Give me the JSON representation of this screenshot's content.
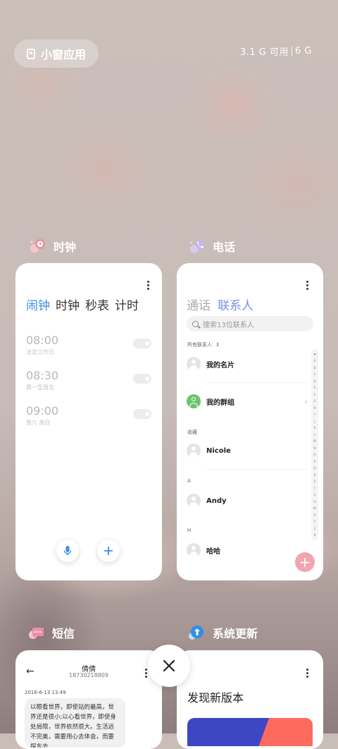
{
  "top": {
    "floating_apps_label": "小窗应用",
    "memory_available": "3.1 G 可用",
    "memory_total": "6 G"
  },
  "cards": {
    "clock": {
      "app_name": "时钟",
      "tabs": [
        "闹钟",
        "时钟",
        "秒表",
        "计时"
      ],
      "active_tab": "闹钟",
      "alarms": [
        {
          "time": "08:00",
          "repeat": "法定工作日",
          "enabled": false
        },
        {
          "time": "08:30",
          "repeat": "周一至周五",
          "enabled": false
        },
        {
          "time": "09:00",
          "repeat": "周六 周日",
          "enabled": false
        }
      ]
    },
    "phone": {
      "app_name": "电话",
      "tab_calls": "通话",
      "tab_contacts": "联系人",
      "search_placeholder": "搜索13位联系人",
      "filter_label": "所有联系人",
      "my_card": "我的名片",
      "my_groups": "我的群组",
      "section_favorites": "收藏",
      "contact_1": "Nicole",
      "section_a": "A",
      "contact_2": "Andy",
      "section_h": "H",
      "contact_3": "哈哈",
      "az_index": [
        "♥",
        "A",
        "B",
        "C",
        "D",
        "E",
        "F",
        "G",
        "H",
        "I",
        "J",
        "K",
        "L",
        "M",
        "N",
        "O",
        "P",
        "Q",
        "R",
        "S",
        "T",
        "U",
        "V",
        "W",
        "X",
        "Y",
        "Z",
        "#"
      ],
      "fab_symbol": "+"
    },
    "sms": {
      "app_name": "短信",
      "contact_name": "倩倩",
      "contact_number": "18730218809",
      "date": "2016-6-13 13:49",
      "message": "以眼看世界，即使站的最高，世界还是很小;以心看世界，即使身处局限，世界依然很大。生活远不完美，需要用心去体会，而要探东去"
    },
    "update": {
      "app_name": "系统更新",
      "title": "发现新版本"
    }
  },
  "icons": {
    "close": "close-icon",
    "mic": "microphone-icon",
    "add": "plus-icon"
  },
  "colors": {
    "accent_blue": "#3c8ee8",
    "contacts_purple": "#7b8fe6",
    "fab_pink": "#f2a4b0",
    "group_green": "#6cc36c"
  }
}
